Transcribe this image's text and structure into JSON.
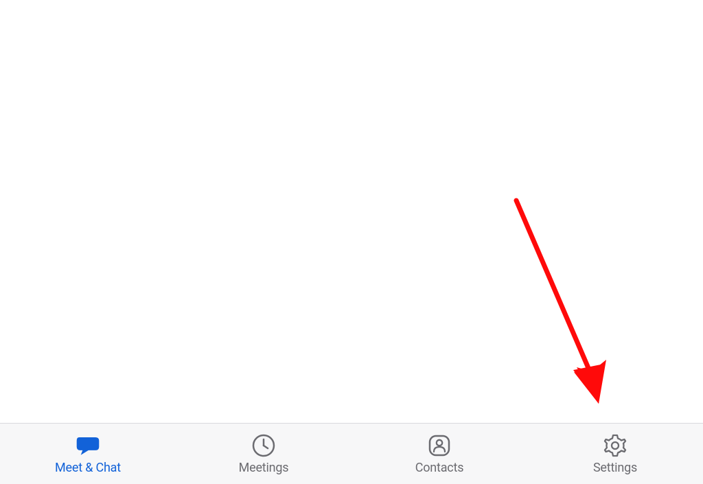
{
  "nav": {
    "items": [
      {
        "label": "Meet & Chat",
        "active": true
      },
      {
        "label": "Meetings",
        "active": false
      },
      {
        "label": "Contacts",
        "active": false
      },
      {
        "label": "Settings",
        "active": false
      }
    ]
  },
  "colors": {
    "accent": "#1262d8",
    "inactive": "#6b6b70",
    "annotation": "#ff0000"
  }
}
